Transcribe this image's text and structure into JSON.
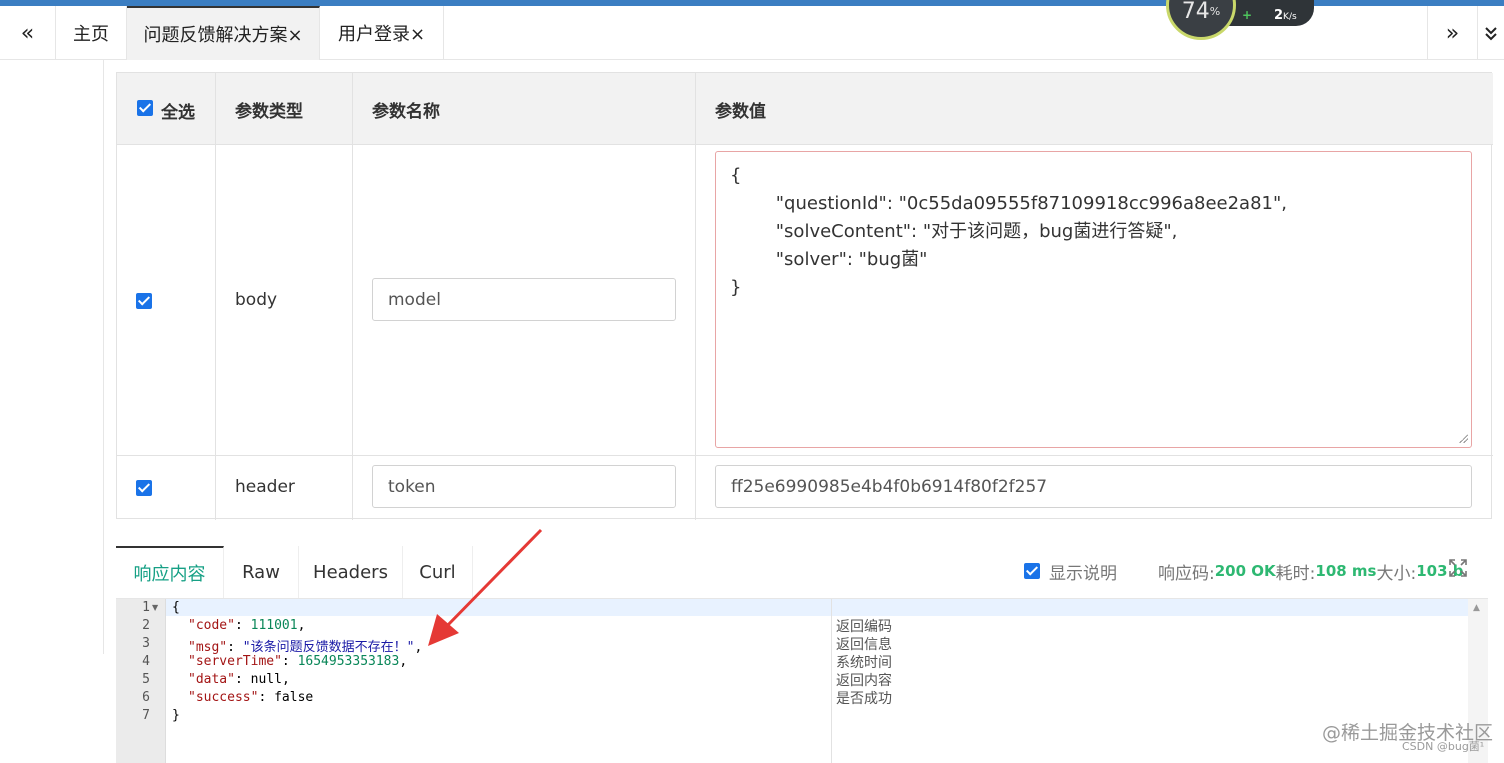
{
  "tabs": {
    "nav_left": "«",
    "nav_right": "»",
    "items": [
      {
        "label": "主页"
      },
      {
        "label": "问题反馈解决方案×"
      },
      {
        "label": "用户登录×"
      }
    ]
  },
  "speed_widget": {
    "percent": "74",
    "percent_unit": "%",
    "plus": "+",
    "rate": "2",
    "rate_unit": "K/s"
  },
  "params_table": {
    "headers": {
      "select_all": "全选",
      "type": "参数类型",
      "name": "参数名称",
      "value": "参数值"
    },
    "rows": [
      {
        "type": "body",
        "name": "model",
        "value": "{\n        \"questionId\": \"0c55da09555f87109918cc996a8ee2a81\",\n        \"solveContent\": \"对于该问题，bug菌进行答疑\",\n        \"solver\": \"bug菌\"\n}"
      },
      {
        "type": "header",
        "name": "token",
        "value": "ff25e6990985e4b4f0b6914f80f2f257"
      }
    ]
  },
  "response": {
    "tabs": [
      "响应内容",
      "Raw",
      "Headers",
      "Curl"
    ],
    "show_desc_label": "显示说明",
    "code_label": "响应码:",
    "code_value": "200 OK",
    "time_label": "耗时:",
    "time_value": "108 ms",
    "size_label": "大小:",
    "size_value": "103 b",
    "line_numbers": [
      "1",
      "2",
      "3",
      "4",
      "5",
      "6",
      "7"
    ],
    "lines": [
      {
        "open": "{"
      },
      {
        "key": "\"code\"",
        "sep": ": ",
        "num": "111001",
        "end": ","
      },
      {
        "key": "\"msg\"",
        "sep": ": ",
        "str": "\"该条问题反馈数据不存在！\"",
        "end": ","
      },
      {
        "key": "\"serverTime\"",
        "sep": ": ",
        "num": "1654953353183",
        "end": ","
      },
      {
        "key": "\"data\"",
        "sep": ": ",
        "lit": "null",
        "end": ","
      },
      {
        "key": "\"success\"",
        "sep": ": ",
        "lit": "false",
        "end": ""
      },
      {
        "close": "}"
      }
    ],
    "notes": [
      "返回编码",
      "返回信息",
      "系统时间",
      "返回内容",
      "是否成功"
    ]
  },
  "watermark": {
    "main": "@稀土掘金技术社区",
    "sub": "CSDN @bug菌¹"
  }
}
